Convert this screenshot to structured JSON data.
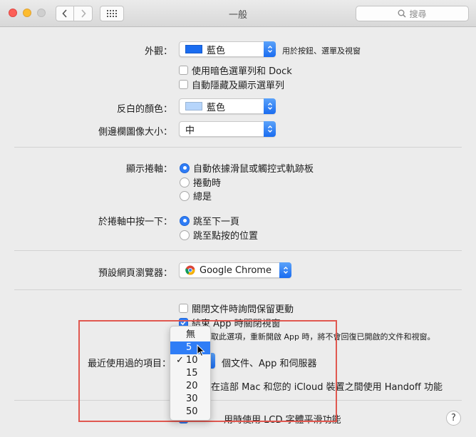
{
  "window": {
    "title": "一般"
  },
  "search": {
    "placeholder": "搜尋"
  },
  "appearance": {
    "label": "外觀：",
    "value": "藍色",
    "hint": "用於按鈕、選單及視窗",
    "swatch": "#1a6cf0"
  },
  "options": {
    "dark_menu": "使用暗色選單列和 Dock",
    "auto_hide": "自動隱藏及顯示選單列"
  },
  "highlight_color": {
    "label": "反白的顏色：",
    "value": "藍色",
    "swatch": "#b6d5fb"
  },
  "sidebar_icon": {
    "label": "側邊欄圖像大小：",
    "value": "中"
  },
  "scrollbars": {
    "label": "顯示捲軸：",
    "opt1": "自動依據滑鼠或觸控式軌跡板",
    "opt2": "捲動時",
    "opt3": "總是"
  },
  "click_scroll": {
    "label": "於捲軸中按一下：",
    "opt1": "跳至下一頁",
    "opt2": "跳至點按的位置"
  },
  "browser": {
    "label": "預設網頁瀏覽器：",
    "value": "Google Chrome"
  },
  "docs": {
    "ask_keep": "關閉文件時詢問保留更動",
    "close_windows": "結束 App 時關閉視窗",
    "note": "取此選項，重新開啟 App 時，將不會回復已開啟的文件和視窗。"
  },
  "recent": {
    "label": "最近使用過的項目：",
    "suffix": "個文件、App 和伺服器"
  },
  "handoff": "在這部 Mac 和您的 iCloud 裝置之間使用 Handoff 功能",
  "lcd": "用時使用 LCD 字體平滑功能",
  "menu": {
    "items": [
      "無",
      "5",
      "10",
      "15",
      "20",
      "30",
      "50"
    ],
    "selected": "5",
    "checked": "10"
  },
  "help": {
    "label": "?"
  }
}
